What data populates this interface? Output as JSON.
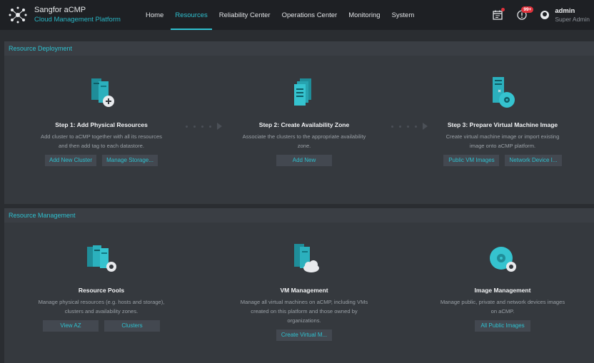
{
  "header": {
    "app_title": "Sangfor aCMP",
    "app_subtitle": "Cloud Management Platform",
    "nav": [
      {
        "label": "Home"
      },
      {
        "label": "Resources"
      },
      {
        "label": "Reliability Center"
      },
      {
        "label": "Operations Center"
      },
      {
        "label": "Monitoring"
      },
      {
        "label": "System"
      }
    ],
    "alert_badge": "99+",
    "user": {
      "name": "admin",
      "role": "Super Admin"
    }
  },
  "deployment": {
    "title": "Resource Deployment",
    "steps": [
      {
        "title": "Step 1: Add Physical Resources",
        "desc": "Add cluster to aCMP together with all its resources and then add tag to each datastore.",
        "buttons": [
          "Add New Cluster",
          "Manage Storage..."
        ]
      },
      {
        "title": "Step 2: Create Availability Zone",
        "desc": "Associate the clusters to the appropriate availability zone.",
        "buttons": [
          "Add New"
        ]
      },
      {
        "title": "Step 3: Prepare Virtual Machine Image",
        "desc": "Create virtual machine image or import existing image onto aCMP platform.",
        "buttons": [
          "Public VM Images",
          "Network Device I..."
        ]
      }
    ]
  },
  "management": {
    "title": "Resource Management",
    "cards": [
      {
        "title": "Resource Pools",
        "desc": "Manage physical resources (e.g. hosts and storage), clusters and availability zones.",
        "buttons": [
          "View AZ",
          "Clusters"
        ]
      },
      {
        "title": "VM Management",
        "desc": "Manage all virtual machines on aCMP, including VMs created on this platform and those owned by organizations.",
        "buttons": [
          "Create Virtual M..."
        ]
      },
      {
        "title": "Image Management",
        "desc": "Manage public, private and network devices images on aCMP.",
        "buttons": [
          "All Public Images"
        ]
      }
    ]
  },
  "colors": {
    "accent": "#2fc0cf",
    "badge": "#e0323c",
    "topbar": "#1e2024",
    "panel": "#35393e"
  }
}
